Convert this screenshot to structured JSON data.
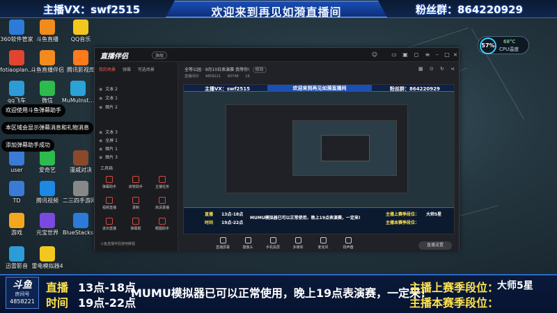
{
  "banner": {
    "left_text": "主播VX：swf2515",
    "title": "欢迎来到再见如漪直播间",
    "right_text": "粉丝群：864220929"
  },
  "desktop": {
    "icons": [
      {
        "label": "360软件管家",
        "color": "#2d7bd8"
      },
      {
        "label": "斗鱼直播",
        "color": "#f28b1e"
      },
      {
        "label": "QQ音乐",
        "color": "#f2c81e"
      },
      {
        "label": "fotiaoplan...",
        "color": "#e2452f"
      },
      {
        "label": "斗鱼直播伴侣",
        "color": "#f28b1e"
      },
      {
        "label": "腾讯影视库",
        "color": "#ff7a1a"
      },
      {
        "label": "qq飞车",
        "color": "#2d9bd8"
      },
      {
        "label": "微信",
        "color": "#2dbb4e"
      },
      {
        "label": "MuMuInst...",
        "color": "#2ba3d6"
      },
      {
        "label": "user",
        "color": "#3a7bd5"
      },
      {
        "label": "爱奇艺",
        "color": "#2dbb4e"
      },
      {
        "label": "漫威对决",
        "color": "#8a4a2a"
      },
      {
        "label": "TD",
        "color": "#3a7bd5"
      },
      {
        "label": "腾讯视频",
        "color": "#1e88e5"
      },
      {
        "label": "二三四手游网红基站",
        "color": "#888888"
      },
      {
        "label": "游戏",
        "color": "#f2a81e"
      },
      {
        "label": "元宝世界",
        "color": "#7a4adf"
      },
      {
        "label": "BlueStacks 主题",
        "color": "#2d7bd8"
      },
      {
        "label": "迅雷影音",
        "color": "#2d9bd8"
      },
      {
        "label": "雷电模拟器4",
        "color": "#f2c81e"
      }
    ]
  },
  "cpu_widget": {
    "percent": "57%",
    "temp": "68°C",
    "label": "CPU温度"
  },
  "app": {
    "logo": "直播伴侣",
    "version": "旗舰",
    "left_tabs": [
      "我的场景",
      "弹幕",
      "可选场景"
    ],
    "scenes": [
      "文本 2",
      "文本 1",
      "图片 2",
      "文本 3",
      "全屏 1",
      "图片 1",
      "图片 3"
    ],
    "tools_title": "工具箱",
    "tools": [
      "弹幕助手",
      "房管助手",
      "主播任务",
      "视频直播",
      "录制",
      "高清录播",
      "进出直播",
      "弹幕姬",
      "截图助手"
    ],
    "footer": "斗鱼直播伴侣使用教程",
    "main_info": "全等公园 · 9月10日表演赛 我等你!",
    "edit_label": "修改",
    "main_sub": [
      "直播间ID",
      "4858221",
      "80748",
      "16"
    ],
    "controls": [
      "直播屏幕",
      "摄像头",
      "手机投屏",
      "多媒体",
      "麦克风",
      "扬声器"
    ],
    "start_label": "直播设置"
  },
  "preview": {
    "left_text": "主播VX：swf2515",
    "title": "欢迎来到再见如漪直播间",
    "right_text": "粉丝群：864220929",
    "time_label_1": "直播",
    "time_label_2": "时间",
    "time_1": "13点-18点",
    "time_2": "19点-22点",
    "marquee": "MUMU模拟器已可以正常使用，晚上19点表演赛，一定来!",
    "rank_1": "主播上赛季段位：",
    "rank_1_value": "大师5星",
    "rank_2": "主播本赛季段位："
  },
  "notifications": [
    "欢迎使用斗鱼弹幕助手",
    "本区域会显示弹幕消息和礼物消息",
    "添加弹幕助手成功"
  ],
  "bottom_bar": {
    "room_logo": "斗鱼",
    "room_label": "房间号",
    "room_number": "4858221",
    "time_label_1": "直播",
    "time_label_2": "时间",
    "time_1": "13点-18点",
    "time_2": "19点-22点",
    "marquee": "MUMU模拟器已可以正常使用，晚上19点表演赛，一定来!",
    "rank_1": "主播上赛季段位：",
    "rank_1_value": "大师5星",
    "rank_2": "主播本赛季段位："
  },
  "colors": {
    "accent_blue": "#2e69c9",
    "yellow_text": "#ffe34d",
    "tool_red": "#d84a3a"
  }
}
